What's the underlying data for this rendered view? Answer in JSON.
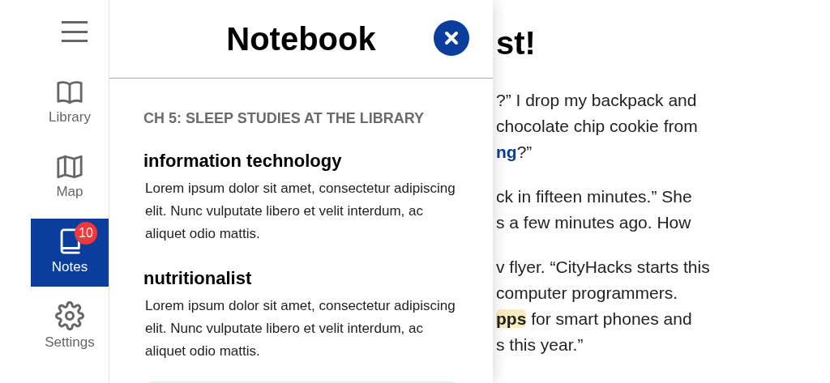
{
  "sidebar": {
    "items": [
      {
        "kind": "library",
        "label": "Library",
        "selected": false
      },
      {
        "kind": "map",
        "label": "Map",
        "selected": false
      },
      {
        "kind": "notes",
        "label": "Notes",
        "selected": true,
        "badge": "10"
      },
      {
        "kind": "settings",
        "label": "Settings",
        "selected": false
      }
    ]
  },
  "notebook": {
    "title": "Notebook",
    "chapter": "CH 5: SLEEP STUDIES AT THE LIBRARY",
    "notes": [
      {
        "term": "information technology",
        "definition": "Lorem ipsum dolor sit amet, consectetur adipiscing elit. Nunc vulputate libero et velit interdum, ac aliquet odio mattis."
      },
      {
        "term": "nutritionalist",
        "definition": "Lorem ipsum dolor sit amet, consectetur adipiscing elit. Nunc vulputate libero et velit interdum, ac aliquet odio mattis."
      }
    ]
  },
  "story": {
    "title": "st!",
    "paragraphs": [
      [
        [
          {
            "text": "?” I drop my backpack and",
            "kind": "plain"
          }
        ],
        [
          {
            "text": "chocolate chip cookie from",
            "kind": "plain"
          }
        ],
        [
          {
            "text": "ng",
            "kind": "link"
          },
          {
            "text": "?”",
            "kind": "plain"
          }
        ]
      ],
      [
        [
          {
            "text": "ck in fifteen minutes.” She",
            "kind": "plain"
          }
        ],
        [
          {
            "text": "s a few minutes ago. How",
            "kind": "plain"
          }
        ]
      ],
      [
        [
          {
            "text": "v flyer. “CityHacks starts this",
            "kind": "plain"
          }
        ],
        [
          {
            "text": "computer programmers.",
            "kind": "plain"
          }
        ],
        [
          {
            "text": "pps",
            "kind": "highlight"
          },
          {
            "text": " for smart phones and",
            "kind": "plain"
          }
        ],
        [
          {
            "text": "s this year.”",
            "kind": "plain"
          }
        ]
      ]
    ]
  }
}
